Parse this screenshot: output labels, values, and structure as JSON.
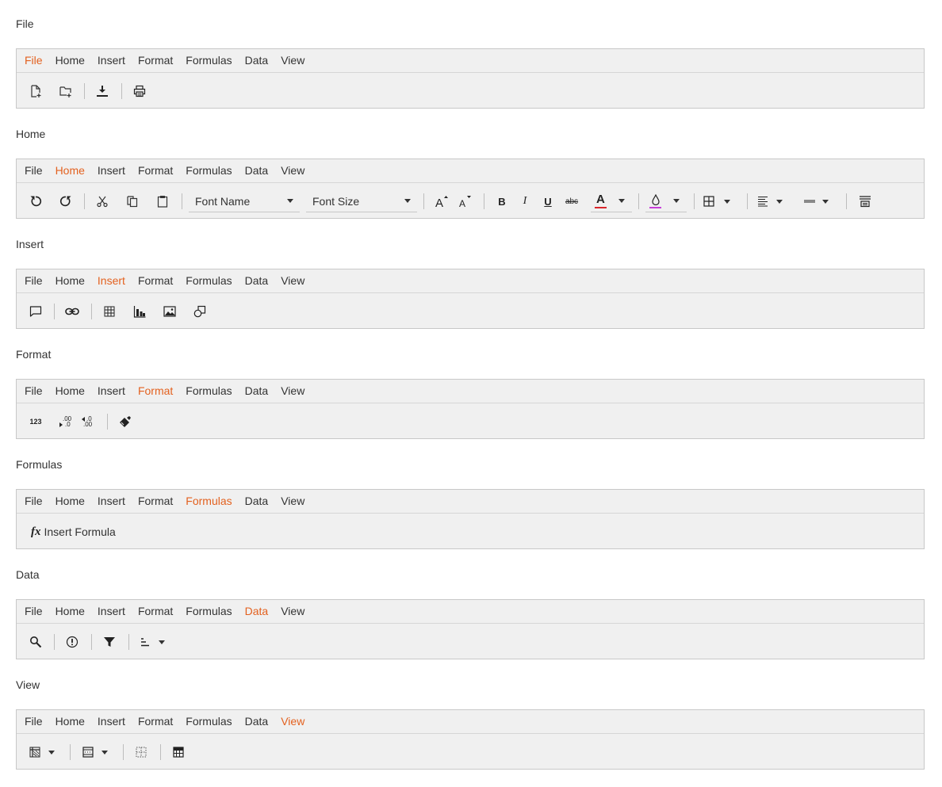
{
  "tabs": [
    "File",
    "Home",
    "Insert",
    "Format",
    "Formulas",
    "Data",
    "View"
  ],
  "sections": {
    "file": "File",
    "home": "Home",
    "insert": "Insert",
    "format": "Format",
    "formulas": "Formulas",
    "data": "Data",
    "view": "View"
  },
  "home_tools": {
    "font_name": "Font Name",
    "font_size": "Font Size",
    "bold": "B",
    "italic": "I",
    "underline": "U",
    "strike": "abc",
    "font_color_glyph": "A"
  },
  "format_tools": {
    "number_format": "123",
    "inc_decimal": ".00",
    "dec_decimal": ".0"
  },
  "formula_tools": {
    "fx": "fx",
    "insert_formula": "Insert Formula"
  },
  "colors": {
    "active_tab": "#e3611f",
    "font_color": "#d9262b",
    "fill_color": "#c73ed8"
  }
}
